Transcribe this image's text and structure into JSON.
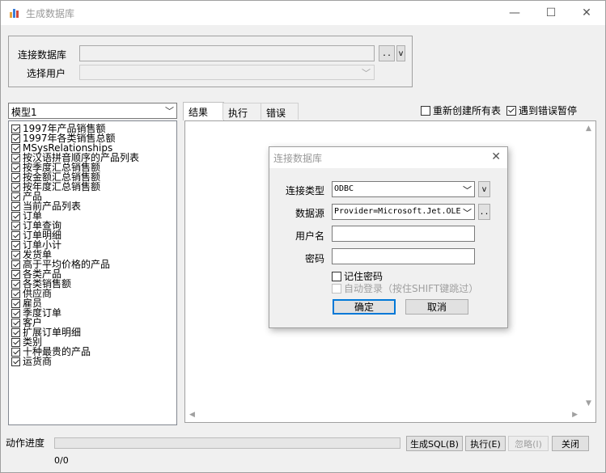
{
  "window": {
    "title": "生成数据库",
    "min_glyph": "—",
    "max_glyph": "☐",
    "close_glyph": "✕"
  },
  "connection": {
    "db_label": "连接数据库",
    "db_value": "",
    "browse_label": "..",
    "dropdown_label": "v",
    "user_label": "选择用户",
    "user_value": ""
  },
  "model": {
    "selected": "模型1"
  },
  "tree_items": [
    "1997年产品销售额",
    "1997年各类销售总额",
    "MSysRelationships",
    "按汉语拼音顺序的产品列表",
    "按季度汇总销售额",
    "按金额汇总销售额",
    "按年度汇总销售额",
    "产品",
    "当前产品列表",
    "订单",
    "订单查询",
    "订单明细",
    "订单小计",
    "发货单",
    "高于平均价格的产品",
    "各类产品",
    "各类销售额",
    "供应商",
    "雇员",
    "季度订单",
    "客户",
    "扩展订单明细",
    "类别",
    "十种最贵的产品",
    "运货商"
  ],
  "tabs": [
    "结果",
    "执行",
    "错误"
  ],
  "options": {
    "recreate_all": "重新创建所有表",
    "recreate_all_checked": false,
    "pause_on_error": "遇到错误暂停",
    "pause_on_error_checked": true
  },
  "progress": {
    "label": "动作进度",
    "count": "0/0",
    "value": 0
  },
  "buttons": {
    "generate": "生成SQL(B)",
    "execute": "执行(E)",
    "ignore": "忽略(I)",
    "close": "关闭"
  },
  "dialog": {
    "title": "连接数据库",
    "close_glyph": "✕",
    "type_label": "连接类型",
    "type_value": "ODBC",
    "type_dropdown": "v",
    "source_label": "数据源",
    "source_value": "Provider=Microsoft.Jet.OLEDB",
    "source_browse": "..",
    "username_label": "用户名",
    "username_value": "",
    "password_label": "密码",
    "password_value": "",
    "remember_label": "记住密码",
    "remember_checked": false,
    "autologin_label": "自动登录（按住SHIFT键跳过）",
    "ok_label": "确定",
    "cancel_label": "取消"
  },
  "colors": {
    "accent": "#0078d7",
    "window_bg": "#f0f0f0",
    "disabled_text": "#a0a0a0"
  }
}
